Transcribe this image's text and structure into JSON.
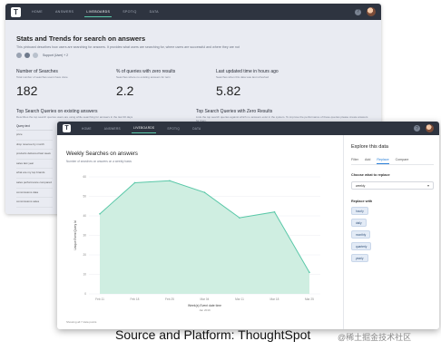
{
  "back_window": {
    "nav": [
      "HOME",
      "ANSWERS",
      "LIVEBOARDS",
      "SPOTIQ",
      "DATA"
    ],
    "help": "?",
    "title": "Stats and Trends for search on answers",
    "description": "This pinboard describes how users are searching for answers. It provides what users are searching for, where users are successful and where they are not",
    "shared_label": "Support (User) + 2",
    "stats": [
      {
        "label": "Number of Searches",
        "sub": "Total number of searches users have done",
        "value": "182"
      },
      {
        "label": "% of queries with zero results",
        "sub": "Searches where no existing answers for term",
        "value": "2.2"
      },
      {
        "label": "Last updated time in hours ago",
        "sub": "Searches when this data was last refreshed",
        "value": "5.82"
      }
    ],
    "tables": [
      {
        "title": "Top Search Queries on existing answers",
        "sub": "Describes the top search queries users are using while searching for answers in the last 30 days"
      },
      {
        "title": "Top Search Queries with Zero Results",
        "sub": "Lists the top search queries against which no answers exist in the system. To improve the performance of these queries please create answers for them."
      }
    ],
    "table_head": "Query text",
    "table_rows": [
      "price",
      "drop revenue by month",
      "products delivered last week",
      "sales last year",
      "what are my top brands",
      "sales performance compared",
      "commissions data",
      "commissions sales"
    ]
  },
  "front_window": {
    "nav": [
      "HOME",
      "ANSWERS",
      "LIVEBOARDS",
      "SPOTIQ",
      "DATA"
    ],
    "help": "?",
    "chart_title": "Weekly Searches on answers",
    "chart_sub": "Number of searches on answers on a weekly basis",
    "footnote": "Showing all 7 data points",
    "side_title": "Explore this data",
    "tabs": [
      "Filter",
      "Add",
      "Replace",
      "Compare"
    ],
    "active_tab": "Replace",
    "choose_label": "Choose what to replace",
    "select_value": "weekly",
    "replace_label": "Replace with",
    "chips": [
      "hourly",
      "daily",
      "monthly",
      "quarterly",
      "yearly"
    ]
  },
  "chart_data": {
    "type": "area",
    "x": [
      "Feb 11",
      "Feb 18",
      "Feb 25",
      "Mar 04",
      "Mar 11",
      "Mar 18",
      "Mar 25"
    ],
    "values": [
      41,
      57,
      58,
      52,
      39,
      42,
      11
    ],
    "ylabel": "Unique Event Query Id",
    "xlabel": "Week(s) Event date time",
    "x_sublabel": "Jan 2019",
    "ylim": [
      0,
      60
    ],
    "yticks": [
      0,
      10,
      20,
      30,
      40,
      50,
      60
    ],
    "fill_color": "#cfeee1",
    "line_color": "#5ac8a8"
  },
  "caption": "Source and Platform: ThoughtSpot",
  "watermark": "@稀土掘金技术社区"
}
